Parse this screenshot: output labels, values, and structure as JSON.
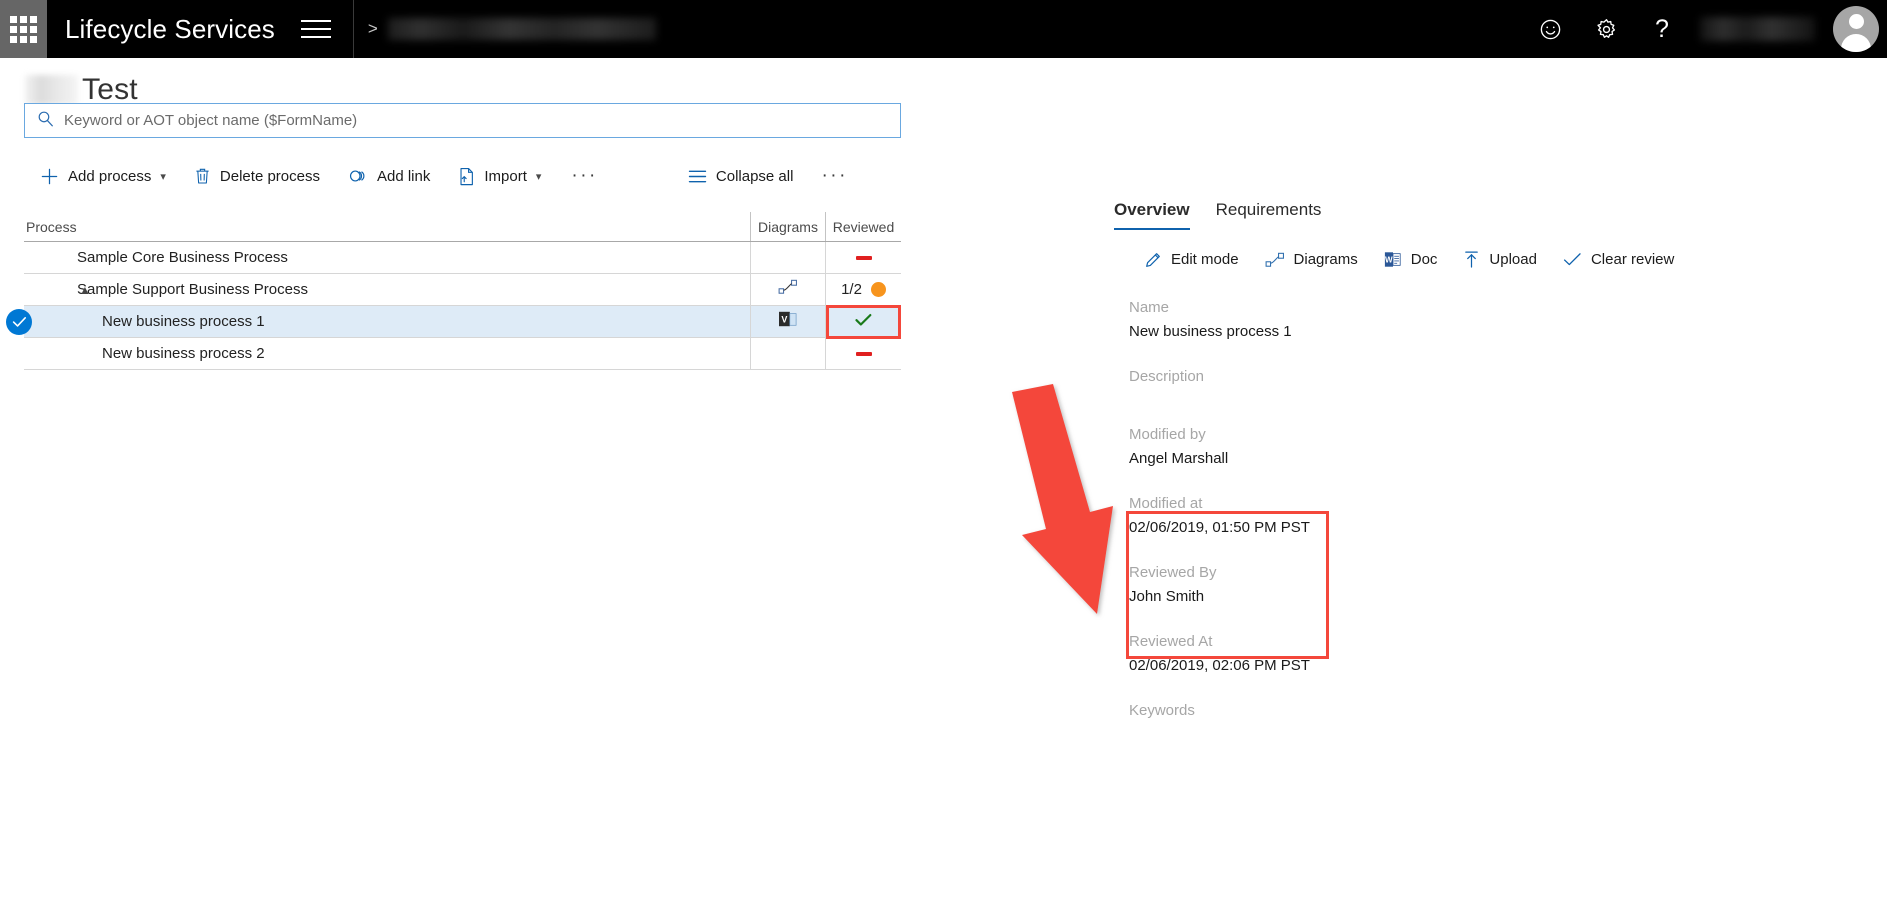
{
  "header": {
    "waffle_icon": "app-launcher-grid-icon",
    "brand": "Lifecycle Services",
    "menu_icon": "hamburger-menu-icon",
    "breadcrumb_separator": ">",
    "breadcrumb_blurred": "",
    "feedback_icon": "smiley-face-icon",
    "settings_icon": "gear-icon",
    "help_icon": "question-mark-icon",
    "user_name_blurred": "",
    "avatar_icon": "user-avatar-icon"
  },
  "page": {
    "title_prefix_blurred": "",
    "title": "Test"
  },
  "search": {
    "placeholder": "Keyword or AOT object name ($FormName)",
    "value": "",
    "icon": "search-icon"
  },
  "toolbar": {
    "add_process": "Add process",
    "delete_process": "Delete process",
    "add_link": "Add link",
    "import": "Import",
    "overflow": "···",
    "collapse_all": "Collapse all",
    "overflow2": "···"
  },
  "table": {
    "columns": [
      "Process",
      "Diagrams",
      "Reviewed"
    ],
    "rows": [
      {
        "name": "Sample Core Business Process",
        "indent": 1,
        "expandable": false,
        "selected": false,
        "diagram_icon": "",
        "reviewed_text": "",
        "reviewed_status": "none"
      },
      {
        "name": "Sample Support Business Process",
        "indent": 1,
        "expandable": true,
        "selected": false,
        "diagram_icon": "diagram-connector-icon",
        "reviewed_text": "1/2",
        "reviewed_status": "partial"
      },
      {
        "name": "New business process 1",
        "indent": 2,
        "expandable": false,
        "selected": true,
        "diagram_icon": "visio-file-icon",
        "reviewed_text": "",
        "reviewed_status": "reviewed"
      },
      {
        "name": "New business process 2",
        "indent": 2,
        "expandable": false,
        "selected": false,
        "diagram_icon": "",
        "reviewed_text": "",
        "reviewed_status": "none"
      }
    ]
  },
  "detail": {
    "tabs": [
      {
        "label": "Overview",
        "active": true
      },
      {
        "label": "Requirements",
        "active": false
      }
    ],
    "commands": [
      {
        "label": "Edit mode",
        "icon": "pencil-icon"
      },
      {
        "label": "Diagrams",
        "icon": "diagram-connector-icon"
      },
      {
        "label": "Doc",
        "icon": "word-document-icon"
      },
      {
        "label": "Upload",
        "icon": "upload-arrow-icon"
      },
      {
        "label": "Clear review",
        "icon": "checkmark-icon"
      }
    ],
    "fields": [
      {
        "label": "Name",
        "value": "New business process 1"
      },
      {
        "label": "Description",
        "value": ""
      },
      {
        "label": "Modified by",
        "value": "Angel Marshall"
      },
      {
        "label": "Modified at",
        "value": "02/06/2019, 01:50 PM PST"
      },
      {
        "label": "Reviewed By",
        "value": "John Smith"
      },
      {
        "label": "Reviewed At",
        "value": "02/06/2019, 02:06 PM PST"
      },
      {
        "label": "Keywords",
        "value": ""
      }
    ]
  },
  "annotation": {
    "color": "#f4473b",
    "arrow": "red-arrow-from-reviewed-cell-to-reviewed-fields",
    "highlight_reviewed_cell": true,
    "highlight_review_fields": true
  },
  "colors": {
    "accent_blue": "#0f62ad",
    "selection_blue": "#0078d4",
    "row_selected_bg": "#deebf7",
    "status_red": "#e02020",
    "status_orange": "#f7941d",
    "status_green": "#1a7a1a",
    "annotation_red": "#f4473b",
    "header_black": "#000000",
    "waffle_gray": "#666666"
  }
}
